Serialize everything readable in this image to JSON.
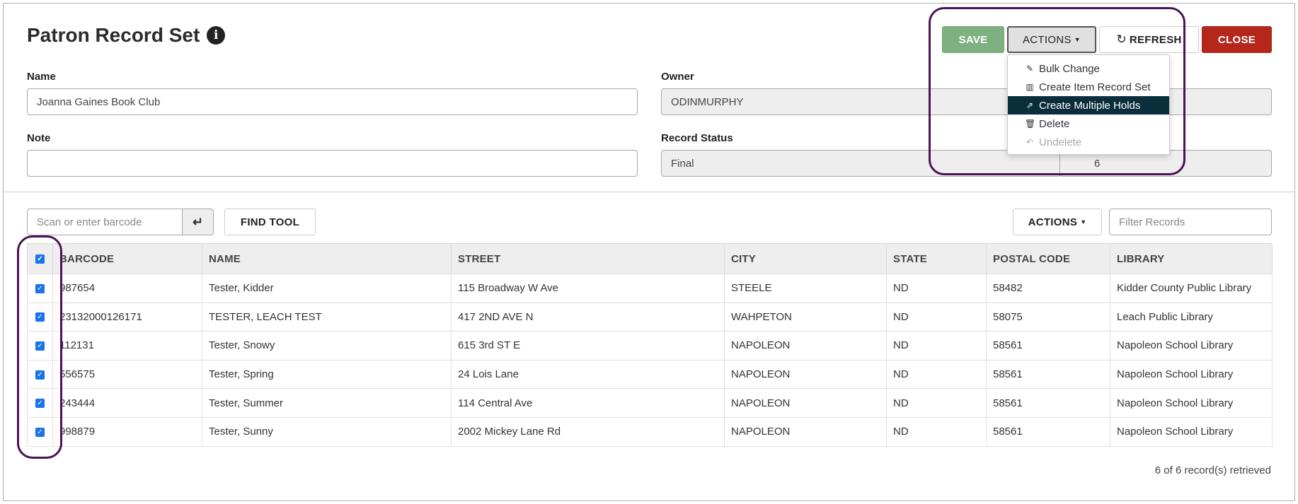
{
  "header": {
    "title": "Patron Record Set",
    "save_label": "SAVE",
    "actions_label": "ACTIONS",
    "refresh_label": "REFRESH",
    "close_label": "CLOSE"
  },
  "form": {
    "name_label": "Name",
    "name_value": "Joanna Gaines Book Club",
    "owner_label": "Owner",
    "owner_value": "ODINMURPHY",
    "note_label": "Note",
    "note_value": "",
    "status_label": "Record Status",
    "status_value": "Final",
    "count_value": "6"
  },
  "actions_menu": {
    "items": [
      {
        "label": "Bulk Change",
        "icon": "pencil-icon"
      },
      {
        "label": "Create Item Record Set",
        "icon": "books-icon"
      },
      {
        "label": "Create Multiple Holds",
        "icon": "share-icon",
        "active": true
      },
      {
        "label": "Delete",
        "icon": "trash-icon"
      },
      {
        "label": "Undelete",
        "icon": "undo-icon",
        "disabled": true
      }
    ]
  },
  "toolbar": {
    "scan_placeholder": "Scan or enter barcode",
    "find_tool_label": "FIND TOOL",
    "actions_label": "ACTIONS",
    "filter_placeholder": "Filter Records"
  },
  "table": {
    "columns": [
      "BARCODE",
      "NAME",
      "STREET",
      "CITY",
      "STATE",
      "POSTAL CODE",
      "LIBRARY"
    ],
    "rows": [
      [
        "987654",
        "Tester, Kidder",
        "115 Broadway W Ave",
        "STEELE",
        "ND",
        "58482",
        "Kidder County Public Library"
      ],
      [
        "23132000126171",
        "TESTER, LEACH TEST",
        "417 2ND AVE N",
        "WAHPETON",
        "ND",
        "58075",
        "Leach Public Library"
      ],
      [
        "112131",
        "Tester, Snowy",
        "615 3rd ST E",
        "NAPOLEON",
        "ND",
        "58561",
        "Napoleon School Library"
      ],
      [
        "556575",
        "Tester, Spring",
        "24 Lois Lane",
        "NAPOLEON",
        "ND",
        "58561",
        "Napoleon School Library"
      ],
      [
        "243444",
        "Tester, Summer",
        "114 Central Ave",
        "NAPOLEON",
        "ND",
        "58561",
        "Napoleon School Library"
      ],
      [
        "998879",
        "Tester, Sunny",
        "2002 Mickey Lane Rd",
        "NAPOLEON",
        "ND",
        "58561",
        "Napoleon School Library"
      ]
    ]
  },
  "footer": {
    "count_text": "6 of 6 record(s) retrieved"
  },
  "colors": {
    "save": "#7fb07f",
    "close": "#b5271b",
    "menu_active": "#0b2e3c",
    "annotation": "#4a1456",
    "checkbox": "#1a73e8"
  }
}
